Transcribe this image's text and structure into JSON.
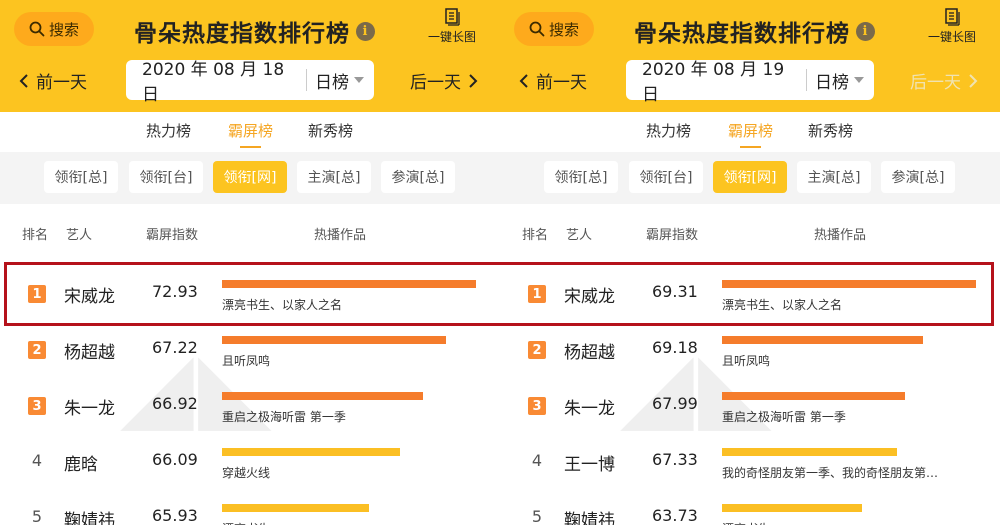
{
  "colors": {
    "header_bg": "#fcc420",
    "search_bg": "#feaa1c",
    "accent": "#f5a623",
    "rank_badge": "#f98a34",
    "bar_orange": "#f57c2b",
    "bar_yellow": "#fbbf24",
    "highlight_border": "#b5121b"
  },
  "panels": [
    {
      "search_label": "搜索",
      "title": "骨朵热度指数排行榜",
      "info_glyph": "i",
      "long_image_label": "一键长图",
      "prev_label": "前一天",
      "next_label": "后一天",
      "next_disabled": false,
      "date": "2020 年 08 月 18 日",
      "period": "日榜",
      "tabs": [
        {
          "label": "热力榜",
          "active": false
        },
        {
          "label": "霸屏榜",
          "active": true
        },
        {
          "label": "新秀榜",
          "active": false
        }
      ],
      "filters": [
        {
          "label": "领衔[总]",
          "active": false
        },
        {
          "label": "领衔[台]",
          "active": false
        },
        {
          "label": "领衔[网]",
          "active": true
        },
        {
          "label": "主演[总]",
          "active": false
        },
        {
          "label": "参演[总]",
          "active": false
        }
      ],
      "columns": [
        "排名",
        "艺人",
        "霸屏指数",
        "热播作品"
      ],
      "rows": [
        {
          "rank": "1",
          "artist": "宋威龙",
          "score": "72.93",
          "works": "漂亮书生、以家人之名",
          "bar_fraction": 1.0,
          "bar_color": "orange"
        },
        {
          "rank": "2",
          "artist": "杨超越",
          "score": "67.22",
          "works": "且听凤鸣",
          "bar_fraction": 0.88,
          "bar_color": "orange"
        },
        {
          "rank": "3",
          "artist": "朱一龙",
          "score": "66.92",
          "works": "重启之极海听雷 第一季",
          "bar_fraction": 0.79,
          "bar_color": "orange"
        },
        {
          "rank": "4",
          "artist": "鹿晗",
          "score": "66.09",
          "works": "穿越火线",
          "bar_fraction": 0.7,
          "bar_color": "yellow"
        },
        {
          "rank": "5",
          "artist": "鞠婧祎",
          "score": "65.93",
          "works": "漂亮书生",
          "bar_fraction": 0.58,
          "bar_color": "yellow"
        }
      ]
    },
    {
      "search_label": "搜索",
      "title": "骨朵热度指数排行榜",
      "info_glyph": "i",
      "long_image_label": "一键长图",
      "prev_label": "前一天",
      "next_label": "后一天",
      "next_disabled": true,
      "date": "2020 年 08 月 19 日",
      "period": "日榜",
      "tabs": [
        {
          "label": "热力榜",
          "active": false
        },
        {
          "label": "霸屏榜",
          "active": true
        },
        {
          "label": "新秀榜",
          "active": false
        }
      ],
      "filters": [
        {
          "label": "领衔[总]",
          "active": false
        },
        {
          "label": "领衔[台]",
          "active": false
        },
        {
          "label": "领衔[网]",
          "active": true
        },
        {
          "label": "主演[总]",
          "active": false
        },
        {
          "label": "参演[总]",
          "active": false
        }
      ],
      "columns": [
        "排名",
        "艺人",
        "霸屏指数",
        "热播作品"
      ],
      "rows": [
        {
          "rank": "1",
          "artist": "宋威龙",
          "score": "69.31",
          "works": "漂亮书生、以家人之名",
          "bar_fraction": 1.0,
          "bar_color": "orange"
        },
        {
          "rank": "2",
          "artist": "杨超越",
          "score": "69.18",
          "works": "且听凤鸣",
          "bar_fraction": 0.79,
          "bar_color": "orange"
        },
        {
          "rank": "3",
          "artist": "朱一龙",
          "score": "67.99",
          "works": "重启之极海听雷 第一季",
          "bar_fraction": 0.72,
          "bar_color": "orange"
        },
        {
          "rank": "4",
          "artist": "王一博",
          "score": "67.33",
          "works": "我的奇怪朋友第一季、我的奇怪朋友第…",
          "bar_fraction": 0.69,
          "bar_color": "yellow"
        },
        {
          "rank": "5",
          "artist": "鞠婧祎",
          "score": "63.73",
          "works": "漂亮书生",
          "bar_fraction": 0.55,
          "bar_color": "yellow"
        }
      ]
    }
  ]
}
